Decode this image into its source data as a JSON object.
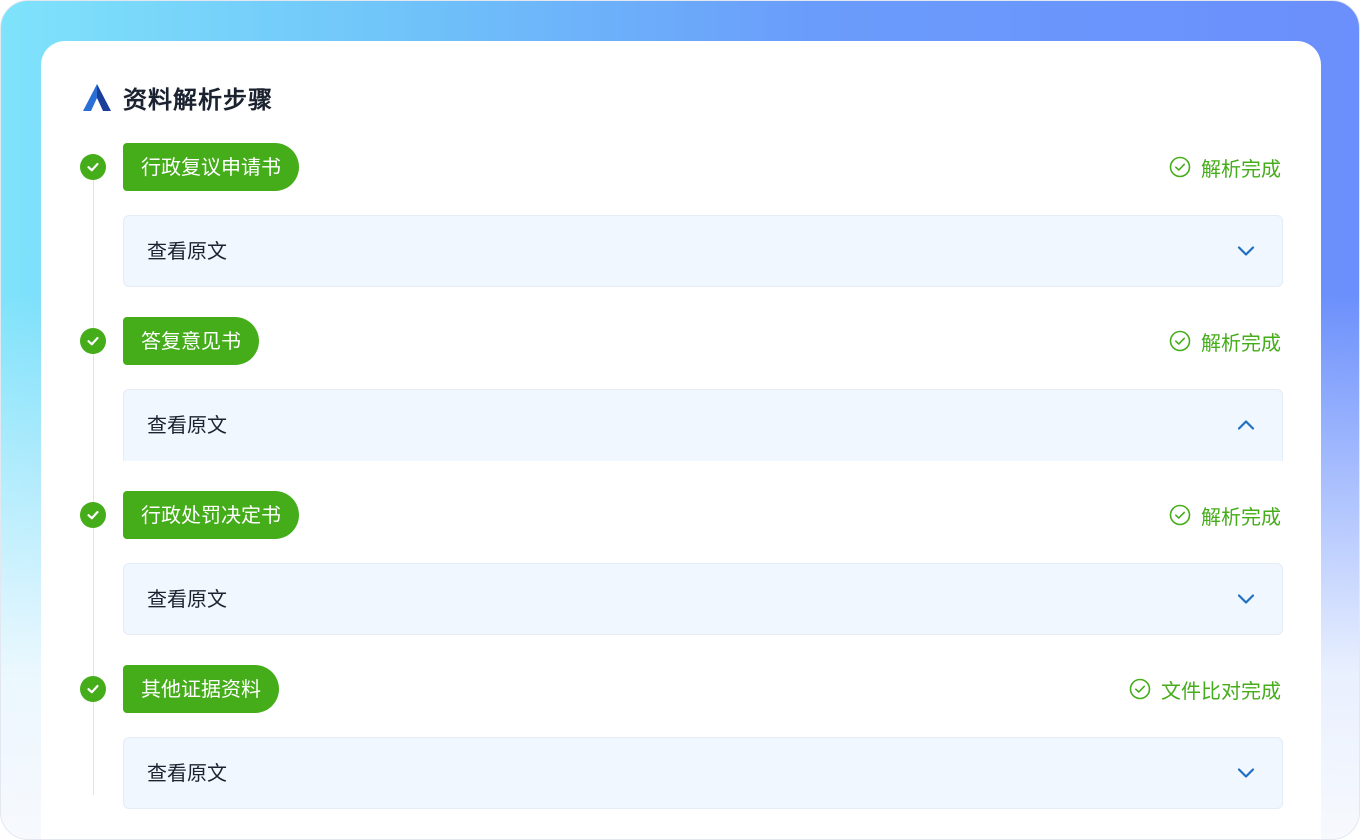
{
  "header": {
    "title": "资料解析步骤",
    "logo_icon": "triangle-logo-icon"
  },
  "colors": {
    "success_green": "#45ac1a",
    "panel_bg": "#f1f7fe",
    "chevron_blue": "#1f6fc2",
    "title_text": "#1c2330"
  },
  "steps": [
    {
      "name": "行政复议申请书",
      "status": "解析完成",
      "panel_label": "查看原文",
      "expanded": false
    },
    {
      "name": "答复意见书",
      "status": "解析完成",
      "panel_label": "查看原文",
      "expanded": true
    },
    {
      "name": "行政处罚决定书",
      "status": "解析完成",
      "panel_label": "查看原文",
      "expanded": false
    },
    {
      "name": "其他证据资料",
      "status": "文件比对完成",
      "panel_label": "查看原文",
      "expanded": false
    }
  ]
}
